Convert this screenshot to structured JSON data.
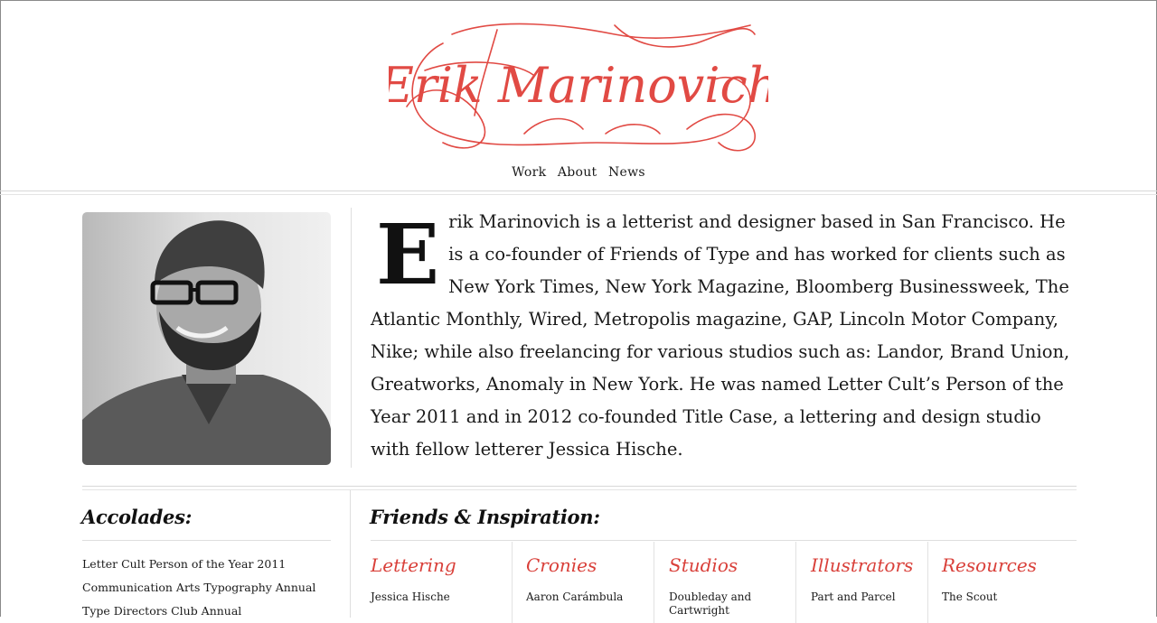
{
  "header": {
    "logo_text": "Erik Marinovich",
    "brand_color": "#e14a44",
    "nav": [
      "Work",
      "About",
      "News"
    ]
  },
  "bio": {
    "dropcap": "E",
    "text": "rik Marinovich is a letterist and designer based in San Francisco. He is a co-founder of Friends of Type and has worked for clients such as New York Times, New York Magazine, Bloomberg Businessweek, The Atlantic Monthly, Wired, Metropolis magazine, GAP, Lincoln Motor Company, Nike; while also freelancing for various studios such as: Landor, Brand Union, Greatworks, Anomaly in New York. He was named Letter Cult’s Person of the Year 2011 and in 2012 co-founded Title Case, a lettering and design studio with fellow letterer Jessica Hische."
  },
  "accolades": {
    "title": "Accolades:",
    "items": [
      "Letter Cult Person of the Year 2011",
      "Communication Arts Typography Annual",
      "Type Directors Club Annual"
    ]
  },
  "friends": {
    "title": "Friends & Inspiration:",
    "columns": [
      {
        "title": "Lettering",
        "first_item": "Jessica Hische"
      },
      {
        "title": "Cronies",
        "first_item": "Aaron Carámbula"
      },
      {
        "title": "Studios",
        "first_item": "Doubleday and Cartwright"
      },
      {
        "title": "Illustrators",
        "first_item": "Part and Parcel"
      },
      {
        "title": "Resources",
        "first_item": "The Scout"
      }
    ]
  }
}
